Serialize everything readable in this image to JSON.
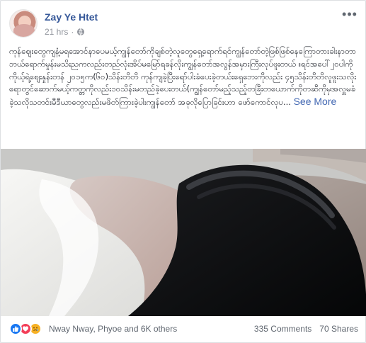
{
  "post": {
    "author": "Zay Ye Htet",
    "time": "21 hrs",
    "body_text": "ကုန်ဈေးတွေကျနံ့မရအောင်နာပေမယ့်ကျွန်တော်ကိုချစ်တဲ့လူတွေရှေ့ရောက်ရင်ကျွန်တော်တဲ့ဖြစ်ဖြစ်နေကြောတားခါးနာတာဘယ်ရောက်မှုန်းမသိးညကလည်းတည်လုံးအိပ်မမြော်ရခန်လိုးကျွန်တော်အလွန်အမှားကြီးလုပ်ဖူးတယ် ။ရင်အပေါ်၂ဝပါကို ကိုယ့်ရဲ့ဈေးနှုန်းတန် ၂၀၁၅က(၆၀)သိန်းတိတိ ကုန်ကျခဲ့ပြီးရော်ပါးခံပေးခဲ့တယ်းရှေဘေးကိုလည်း ၄၅သိန်းတိတိလူဖူးသလိုးရောတွင်ဆောက်မယ့်ကတ္တကိုလည်း၁၀သိန်းမတည်ခဲ့ပေးတယ်(ကျွန်တော်မည့်သည့်တခြီးတယောက်ကိုတဆီကိုမှအလှူမခံခဲ့သလိုသတင်းမီဒီယာတွေလည်းမဖိတ်ကြားခဲ့ပါးကျွန်တော် အခုလိုပြောခြင်းဟာ ဖော်ကောင်လုပ...",
    "see_more": "See More",
    "reactions_label": "Nway Nway, Phyoe and 6K others",
    "comments": "335 Comments",
    "shares": "70 Shares"
  },
  "icons": [
    "globe-icon",
    "more-options-icon",
    "like-reaction-icon",
    "love-reaction-icon",
    "sad-reaction-icon"
  ],
  "colors": {
    "author_link": "#365899",
    "see_more_link": "#4267b2",
    "like": "#1877f2",
    "love": "#f33e58",
    "sad": "#f7b125"
  }
}
